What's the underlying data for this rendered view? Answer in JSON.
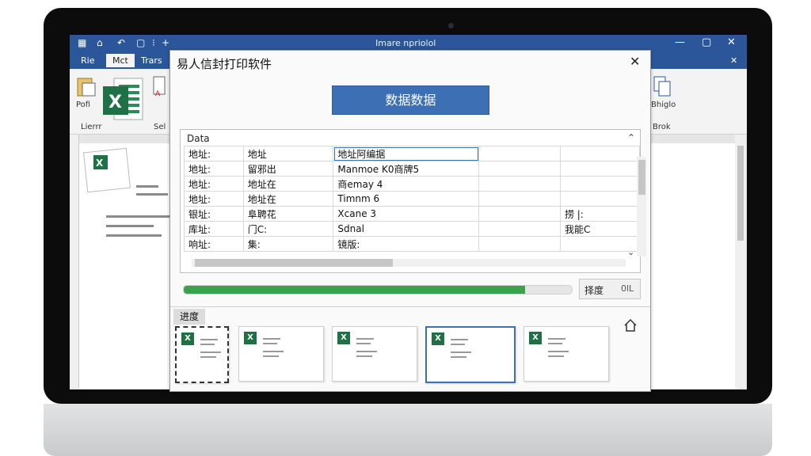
{
  "word": {
    "title": "Imare npriolol",
    "tabs": [
      "Rie",
      "Mct",
      "Trars"
    ],
    "active_tab": 1,
    "ribbon_left_labels": [
      "Pofi",
      "Lierrr",
      "Sel"
    ],
    "ribbon_right_labels": [
      "Bhiglo",
      "Brok"
    ]
  },
  "dialog": {
    "title": "易人信封打印软件",
    "data_button": "数据数据",
    "grid": {
      "header": "Data",
      "rows": [
        [
          "地址:",
          "地址",
          "地址阿编据",
          "",
          ""
        ],
        [
          "地址:",
          "留邪出",
          "Manmoe K0商牌5",
          "",
          ""
        ],
        [
          "地址:",
          "地址在",
          "商emay 4",
          "",
          ""
        ],
        [
          "地址:",
          "地址在",
          "Timnm 6",
          "",
          ""
        ],
        [
          "银址:",
          "阜聘花",
          "Xcane 3",
          "",
          "捞 |:"
        ],
        [
          "库址:",
          "门C:",
          "Sdnal",
          "",
          "我能C"
        ],
        [
          "响址:",
          "集:",
          "镜版:",
          "",
          ""
        ]
      ]
    },
    "progress": {
      "label": "择度",
      "value_text": "0lL",
      "fraction": 0.88
    },
    "templates_label": "进度",
    "templates": [
      {
        "dashed": true,
        "selected": false
      },
      {
        "dashed": false,
        "selected": false
      },
      {
        "dashed": false,
        "selected": false
      },
      {
        "dashed": false,
        "selected": true
      },
      {
        "dashed": false,
        "selected": false
      }
    ]
  },
  "colors": {
    "word_blue": "#2b579a",
    "button_blue": "#3d6fb5",
    "progress_green": "#3ea04b",
    "excel_green": "#1e7145"
  },
  "icons": [
    "excel-icon",
    "home-icon",
    "close-icon",
    "save-icon",
    "undo-icon"
  ]
}
